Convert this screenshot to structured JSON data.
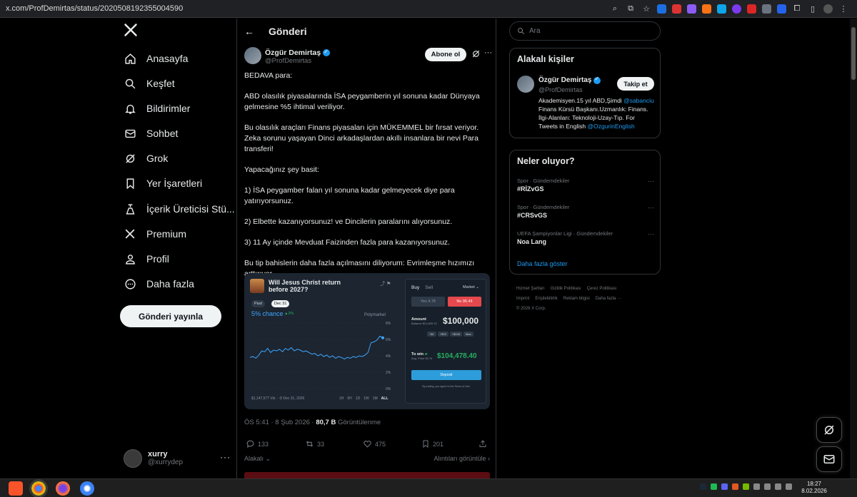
{
  "browser": {
    "url": "x.com/ProfDemirtas/status/2020508192355004590"
  },
  "nav": {
    "items": [
      {
        "label": "Anasayfa",
        "icon": "home-icon"
      },
      {
        "label": "Keşfet",
        "icon": "search-icon"
      },
      {
        "label": "Bildirimler",
        "icon": "bell-icon"
      },
      {
        "label": "Sohbet",
        "icon": "mail-icon"
      },
      {
        "label": "Grok",
        "icon": "grok-icon"
      },
      {
        "label": "Yer İşaretleri",
        "icon": "bookmark-icon"
      },
      {
        "label": "İçerik Üreticisi Stü...",
        "icon": "creator-studio-icon"
      },
      {
        "label": "Premium",
        "icon": "x-premium-icon"
      },
      {
        "label": "Profil",
        "icon": "user-icon"
      },
      {
        "label": "Daha fazla",
        "icon": "more-circle-icon"
      }
    ],
    "post_button": "Gönderi yayınla",
    "account": {
      "name": "xurry",
      "handle": "@xurrydep"
    }
  },
  "center": {
    "title": "Gönderi",
    "author": {
      "name": "Özgür Demirtaş",
      "handle": "@ProfDemirtas"
    },
    "follow_label": "Abone ol",
    "tweet_paragraphs": [
      "BEDAVA para:",
      "ABD olasılık piyasalarında İSA peygamberin yıl sonuna kadar Dünyaya gelmesine %5 ihtimal veriliyor.",
      "Bu olasılık araçları Finans piyasaları için MÜKEMMEL bir fırsat veriyor. Zeka sorunu yaşayan Dinci arkadaşlardan akıllı insanlara bir nevi Para transferi!",
      "Yapacağınız şey basit:",
      "1) İSA peygamber falan yıl sonuna kadar gelmeyecek diye para yatırıyorsunuz.",
      "2) Elbette kazanıyorsunuz! ve Dincilerin paralarını alıyorsunuz.",
      "3) 11 Ay içinde Mevduat Faizinden fazla para kazanıyorsunuz.",
      "Bu tip bahislerin daha fazla açılmasını diliyorum: Evrimleşme hızımızı arttırıyor."
    ],
    "media": {
      "market_title": "Will Jesus Christ return before 2027?",
      "pill_past": "Past",
      "pill_date": "Dec 31",
      "chance": "5% chance",
      "chance_delta": "▲2%",
      "brand": "Polymarket",
      "volume": "$1,147,577 Vol.",
      "end_date": "Dec 31, 2026",
      "ranges": [
        "1H",
        "6H",
        "1D",
        "1W",
        "1M",
        "ALL"
      ],
      "ranges_active": "ALL",
      "buy": "Buy",
      "sell": "Sell",
      "market": "Market",
      "yes": "Yes 4.7¢",
      "no": "No 95.4¢",
      "amount_label": "Amount",
      "balance": "Balance $21,809.70",
      "amount_value": "$100,000",
      "chips": [
        "+$1",
        "+$20",
        "+$100",
        "Max"
      ],
      "to_win_label": "To win",
      "avg_price": "Avg. Price 95.7¢",
      "to_win_value": "$104,478.40",
      "deposit": "Deposit",
      "terms": "By trading, you agree to the Terms of Use.",
      "y_ticks": [
        "8%",
        "6%",
        "4%",
        "2%",
        "0%"
      ],
      "series": [
        3.8,
        3.9,
        3.7,
        4.1,
        4.6,
        4.5,
        4.9,
        4.4,
        4.7,
        4.6,
        4.8,
        4.5,
        4.9,
        4.7,
        5.0,
        4.6,
        4.8,
        4.7,
        4.5,
        4.6,
        4.4,
        4.2,
        4.3,
        4.0,
        4.2,
        3.9,
        4.1,
        3.8,
        4.0,
        3.7,
        3.9,
        3.8,
        3.6,
        3.8,
        3.7,
        3.9,
        3.8,
        4.0,
        3.9,
        4.1,
        4.4,
        5.6,
        5.7,
        5.9,
        6.4,
        6.2
      ]
    },
    "meta_time": "ÖS 5:41 · 8 Şub 2026 · ",
    "meta_views": "80,7 B",
    "meta_views_label": " Görüntülenme",
    "actions": {
      "replies": "133",
      "reposts": "33",
      "likes": "475",
      "bookmarks": "201"
    },
    "sort_left": "Alakalı",
    "sort_right": "Alıntıları görüntüle"
  },
  "right": {
    "search_placeholder": "Ara",
    "related_title": "Alakalı kişiler",
    "related": {
      "name": "Özgür Demirtaş",
      "handle": "@ProfDemirtas",
      "follow": "Takip et",
      "bio_1": "Akademisyen.15 yıl ABD,Şimdi ",
      "bio_link_1": "@sabanciu",
      "bio_2": " Finans Kürsü Başkanı.Uzmanlık: Finans. İlgi-Alanları: Teknoloji-Uzay-Tıp. For Tweets in English ",
      "bio_link_2": "@OzgurinEnglish"
    },
    "trends_title": "Neler oluyor?",
    "trends": [
      {
        "category": "Spor · Gündemdekiler",
        "name": "#RİZvGS"
      },
      {
        "category": "Spor · Gündemdekiler",
        "name": "#CRSvGS"
      },
      {
        "category": "UEFA Şampiyonlar Ligi · Gündemdekiler",
        "name": "Noa Lang"
      }
    ],
    "show_more": "Daha fazla göster",
    "footer": [
      "Hizmet Şartları",
      "Gizlilik Politikası",
      "Çerez Politikası",
      "Imprint",
      "Erişilebilirlik",
      "Reklam bilgisi",
      "Daha fazla ···",
      "© 2026 X Corp."
    ]
  },
  "taskbar": {
    "time": "18:27",
    "date": "8.02.2026"
  }
}
